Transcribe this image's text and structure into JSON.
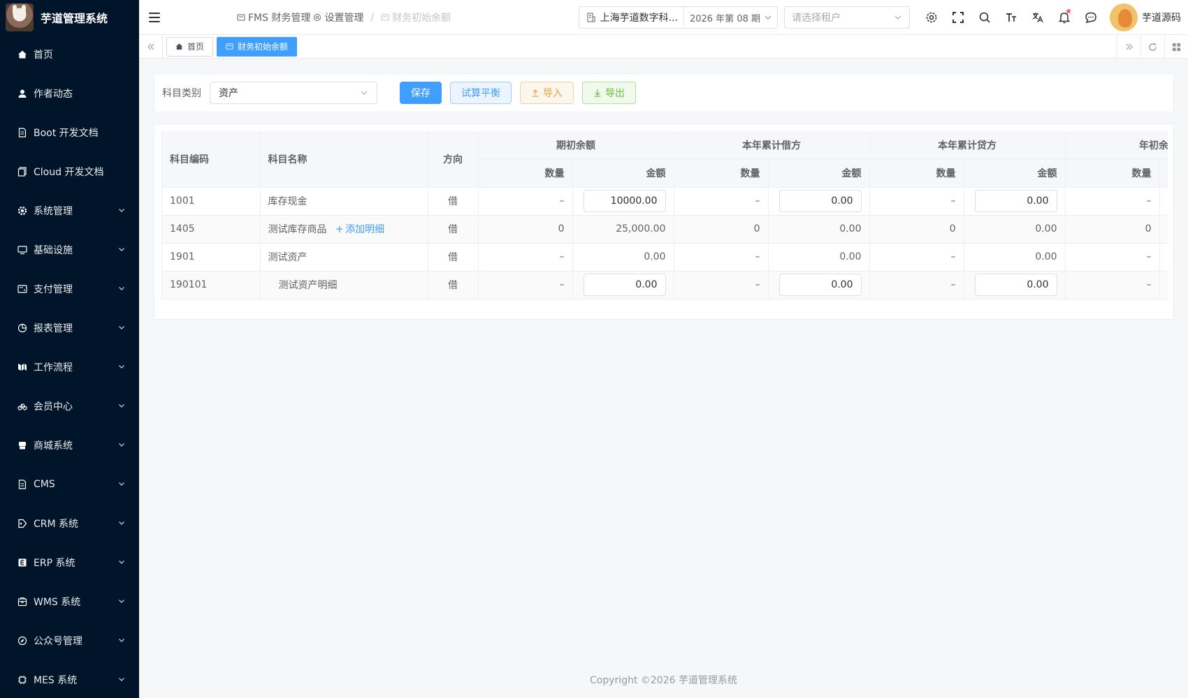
{
  "app": {
    "title": "芋道管理系统"
  },
  "sidebar": {
    "items": [
      {
        "label": "首页",
        "icon": "home-icon",
        "expandable": false
      },
      {
        "label": "作者动态",
        "icon": "user-icon",
        "expandable": false
      },
      {
        "label": "Boot 开发文档",
        "icon": "document-icon",
        "expandable": false
      },
      {
        "label": "Cloud 开发文档",
        "icon": "documents-icon",
        "expandable": false
      },
      {
        "label": "系统管理",
        "icon": "gear-icon",
        "expandable": true
      },
      {
        "label": "基础设施",
        "icon": "monitor-icon",
        "expandable": true
      },
      {
        "label": "支付管理",
        "icon": "wallet-icon",
        "expandable": true
      },
      {
        "label": "报表管理",
        "icon": "pie-chart-icon",
        "expandable": true
      },
      {
        "label": "工作流程",
        "icon": "workflow-icon",
        "expandable": true
      },
      {
        "label": "会员中心",
        "icon": "bicycle-icon",
        "expandable": true
      },
      {
        "label": "商城系统",
        "icon": "store-icon",
        "expandable": true
      },
      {
        "label": "CMS",
        "icon": "document-icon",
        "expandable": true
      },
      {
        "label": "CRM 系统",
        "icon": "crm-icon",
        "expandable": true
      },
      {
        "label": "ERP 系统",
        "icon": "erp-icon",
        "expandable": true
      },
      {
        "label": "WMS 系统",
        "icon": "package-icon",
        "expandable": true
      },
      {
        "label": "公众号管理",
        "icon": "compass-icon",
        "expandable": true
      },
      {
        "label": "MES 系统",
        "icon": "chip-icon",
        "expandable": true
      }
    ]
  },
  "header": {
    "breadcrumb": [
      "FMS 财务管理",
      "设置管理",
      "财务初始余额"
    ],
    "company": "上海芋道数字科...",
    "period": "2026 年第 08 期",
    "tenant_placeholder": "请选择租户",
    "username": "芋道源码",
    "icons": [
      "gear-icon",
      "fullscreen-icon",
      "search-icon",
      "font-size-icon",
      "translate-icon",
      "bell-icon",
      "chat-icon"
    ]
  },
  "tabs": [
    {
      "label": "首页",
      "active": false
    },
    {
      "label": "财务初始余额",
      "active": true
    }
  ],
  "filter": {
    "label": "科目类别",
    "value": "资产",
    "buttons": {
      "save": "保存",
      "trial": "试算平衡",
      "import": "导入",
      "export": "导出"
    }
  },
  "table": {
    "headers": {
      "code": "科目编码",
      "name": "科目名称",
      "direction": "方向",
      "groups": [
        "期初余额",
        "本年累计借方",
        "本年累计贷方",
        "年初余额"
      ],
      "qty": "数量",
      "amount": "金额"
    },
    "rows": [
      {
        "code": "1001",
        "name": "库存现金",
        "link": "",
        "direction": "借",
        "q1": "–",
        "a1": "10000.00",
        "q2": "–",
        "a2": "0.00",
        "q3": "–",
        "a3": "0.00",
        "q4": "–",
        "editable": true,
        "indent": false
      },
      {
        "code": "1405",
        "name": "测试库存商品",
        "link": "添加明细",
        "direction": "借",
        "q1": "0",
        "a1": "25,000.00",
        "q2": "0",
        "a2": "0.00",
        "q3": "0",
        "a3": "0.00",
        "q4": "0",
        "editable": false,
        "indent": false
      },
      {
        "code": "1901",
        "name": "测试资产",
        "link": "",
        "direction": "借",
        "q1": "–",
        "a1": "0.00",
        "q2": "–",
        "a2": "0.00",
        "q3": "–",
        "a3": "0.00",
        "q4": "–",
        "editable": false,
        "indent": false
      },
      {
        "code": "190101",
        "name": "测试资产明细",
        "link": "",
        "direction": "借",
        "q1": "–",
        "a1": "0.00",
        "q2": "–",
        "a2": "0.00",
        "q3": "–",
        "a3": "0.00",
        "q4": "–",
        "editable": true,
        "indent": true
      }
    ]
  },
  "footer": {
    "text": "Copyright ©2026 芋道管理系统"
  },
  "colors": {
    "sidebar_bg": "#001529",
    "primary": "#409eff",
    "warning": "#e6a23c",
    "success": "#67c23a"
  }
}
